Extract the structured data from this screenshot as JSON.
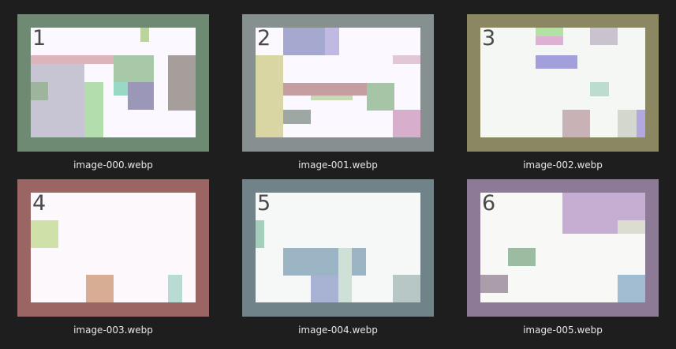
{
  "items": [
    {
      "number": "1",
      "filename": "image-000.webp",
      "frame": "#6f8a72",
      "bg": "#fcf8ff"
    },
    {
      "number": "2",
      "filename": "image-001.webp",
      "frame": "#879090",
      "bg": "#fcf8ff"
    },
    {
      "number": "3",
      "filename": "image-002.webp",
      "frame": "#8c8763",
      "bg": "#f4f7f3"
    },
    {
      "number": "4",
      "filename": "image-003.webp",
      "frame": "#9a6562",
      "bg": "#fcf8fc"
    },
    {
      "number": "5",
      "filename": "image-004.webp",
      "frame": "#6f8388",
      "bg": "#f5f8f6"
    },
    {
      "number": "6",
      "filename": "image-005.webp",
      "frame": "#8d7a97",
      "bg": "#f8f8f6"
    }
  ]
}
